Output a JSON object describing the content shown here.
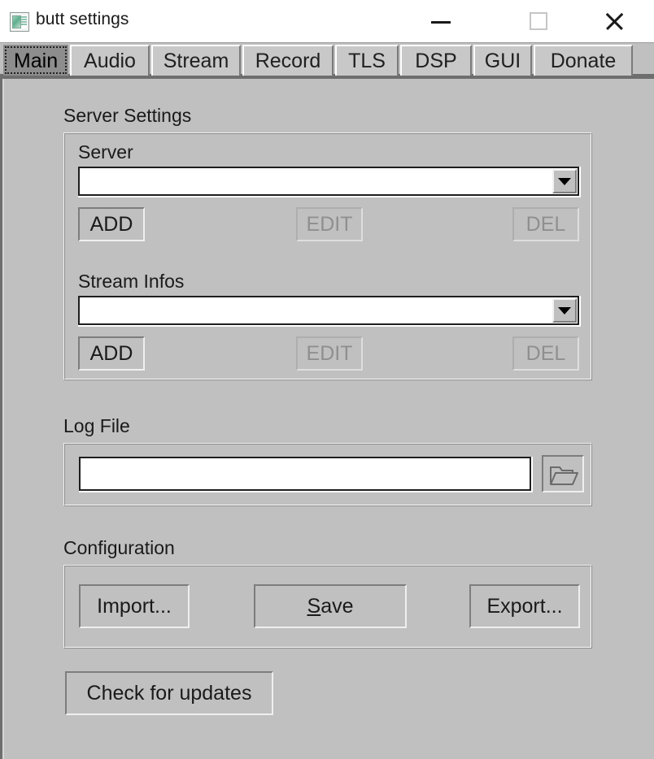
{
  "window": {
    "title": "butt settings",
    "icon": "app-window-icon",
    "controls": {
      "minimize": "minimize-icon",
      "maximize": "maximize-icon",
      "close": "close-icon"
    }
  },
  "tabs": [
    {
      "label": "Main",
      "active": true
    },
    {
      "label": "Audio",
      "active": false
    },
    {
      "label": "Stream",
      "active": false
    },
    {
      "label": "Record",
      "active": false
    },
    {
      "label": "TLS",
      "active": false
    },
    {
      "label": "DSP",
      "active": false
    },
    {
      "label": "GUI",
      "active": false
    },
    {
      "label": "Donate",
      "active": false
    }
  ],
  "server_settings": {
    "group_label": "Server Settings",
    "server": {
      "label": "Server",
      "value": "",
      "dropdown_icon": "chevron-down-icon",
      "add_label": "ADD",
      "edit_label": "EDIT",
      "del_label": "DEL",
      "edit_disabled": true,
      "del_disabled": true
    },
    "stream_infos": {
      "label": "Stream Infos",
      "value": "",
      "dropdown_icon": "chevron-down-icon",
      "add_label": "ADD",
      "edit_label": "EDIT",
      "del_label": "DEL",
      "edit_disabled": true,
      "del_disabled": true
    }
  },
  "log_file": {
    "group_label": "Log File",
    "value": "",
    "placeholder": "",
    "browse_icon": "folder-open-icon"
  },
  "configuration": {
    "group_label": "Configuration",
    "import_label": "Import...",
    "save_label_prefix": "S",
    "save_label_rest": "ave",
    "export_label": "Export..."
  },
  "updates": {
    "check_label": "Check for updates"
  },
  "colors": {
    "window_bg": "#c0c0c0",
    "titlebar_bg": "#ffffff",
    "active_tab_bg": "#8d8d8d",
    "tab_bg": "#c8c8c8",
    "text": "#1a1a1a",
    "disabled_text": "#8f8f8f",
    "field_bg": "#ffffff",
    "separator": "#6e6e6e"
  }
}
